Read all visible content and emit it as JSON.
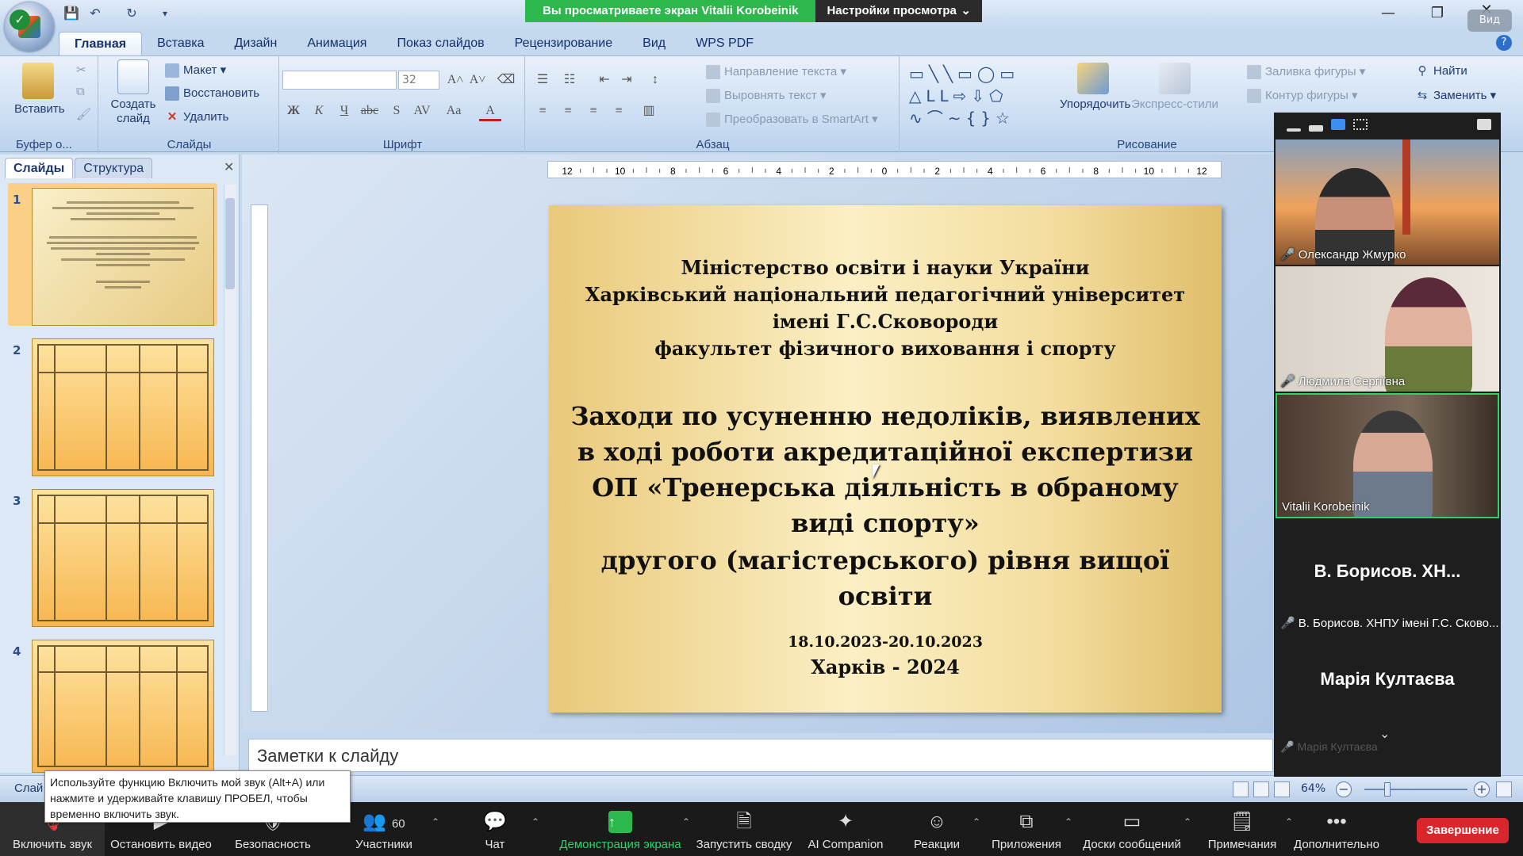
{
  "share_banner": {
    "viewing_text": "Вы просматриваете экран Vitalii Korobeinik",
    "view_settings": "Настройки просмотра",
    "view_btn": "Вид"
  },
  "ribbon": {
    "tabs": [
      "Главная",
      "Вставка",
      "Дизайн",
      "Анимация",
      "Показ слайдов",
      "Рецензирование",
      "Вид",
      "WPS PDF"
    ],
    "clipboard": {
      "paste": "Вставить",
      "label": "Буфер о..."
    },
    "slides": {
      "create": "Создать слайд",
      "layout": "Макет",
      "restore": "Восстановить",
      "delete": "Удалить",
      "label": "Слайды"
    },
    "font": {
      "size": "32",
      "label": "Шрифт"
    },
    "paragraph": {
      "text_direction": "Направление текста",
      "align_text": "Выровнять текст",
      "smartart": "Преобразовать в SmartArt",
      "label": "Абзац"
    },
    "drawing": {
      "arrange": "Упорядочить",
      "express": "Экспресс-стили",
      "fill": "Заливка фигуры",
      "outline": "Контур фигуры",
      "label": "Рисование"
    },
    "editing": {
      "find": "Найти",
      "replace": "Заменить"
    }
  },
  "left_panel": {
    "tab_slides": "Слайды",
    "tab_structure": "Структура",
    "slide_numbers": [
      "1",
      "2",
      "3",
      "4"
    ]
  },
  "slide": {
    "ministry": "Міністерство освіти і науки України",
    "university": "Харківський національний педагогічний університет",
    "university_name": "імені Г.С.Сковороди",
    "faculty": "факультет фізичного виховання і спорту",
    "title": "Заходи по усуненню недоліків, виявлених в ході роботи акредитаційної експертизи ОП «Тренерська діяльність в обраному виді спорту»",
    "subtitle": "другого (магістерського) рівня вищої освіти",
    "dates": "18.10.2023-20.10.2023",
    "city": "Харків - 2024"
  },
  "ruler": {
    "ticks": [
      "12",
      "10",
      "8",
      "6",
      "4",
      "2",
      "0",
      "2",
      "4",
      "6",
      "8",
      "10",
      "12"
    ]
  },
  "notes_placeholder": "Заметки к слайду",
  "status": {
    "zoom": "64%",
    "slide_label": "Слай"
  },
  "tooltip": "Используйте функцию Включить мой звук (Alt+A) или нажмите и удерживайте клавишу ПРОБЕЛ, чтобы временно включить звук.",
  "participants": [
    {
      "name": "Олександр Жмурко",
      "muted": true
    },
    {
      "name": "Людмила Сергіївна",
      "muted": true
    },
    {
      "name": "Vitalii Korobeinik",
      "muted": false
    },
    {
      "big": "В. Борисов. ХН...",
      "name": "В. Борисов. ХНПУ імені Г.С. Сково...",
      "muted": true
    },
    {
      "big": "Марія  Култаєва",
      "name": "Марія  Култаєва",
      "muted": true
    }
  ],
  "zoom_toolbar": {
    "unmute": "Включить звук",
    "stop_video": "Остановить видео",
    "security": "Безопасность",
    "participants": "Участники",
    "participants_count": "60",
    "chat": "Чат",
    "share": "Демонстрация экрана",
    "summary": "Запустить сводку",
    "ai": "AI Companion",
    "reactions": "Реакции",
    "apps": "Приложения",
    "whiteboards": "Доски сообщений",
    "notes": "Примечания",
    "more": "Дополнительно",
    "end": "Завершение"
  },
  "colors": {
    "share_green": "#2db84d",
    "end_red": "#d9262c",
    "slide_gold": "#f3dd9e"
  }
}
